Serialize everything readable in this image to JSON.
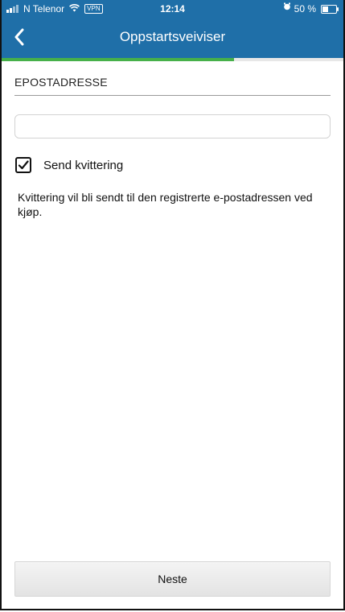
{
  "status_bar": {
    "carrier": "N Telenor",
    "vpn": "VPN",
    "time": "12:14",
    "battery": "50 %",
    "battery_level": 0.5
  },
  "nav": {
    "title": "Oppstartsveiviser"
  },
  "progress": {
    "fraction": 0.68,
    "fill_color": "#46b04a"
  },
  "form": {
    "section_label": "EPOSTADRESSE",
    "email_value": "",
    "email_placeholder": "",
    "checkbox_label": "Send kvittering",
    "checkbox_checked": true,
    "info_text": "Kvittering vil bli sendt til den registrerte e-postadressen ved kjøp."
  },
  "footer": {
    "next_label": "Neste"
  },
  "colors": {
    "header_bg": "#1f6fa8"
  },
  "icons": {
    "back": "chevron-left-icon",
    "wifi": "wifi-icon",
    "alarm": "alarm-icon",
    "battery": "battery-icon",
    "check": "checkmark-icon"
  }
}
